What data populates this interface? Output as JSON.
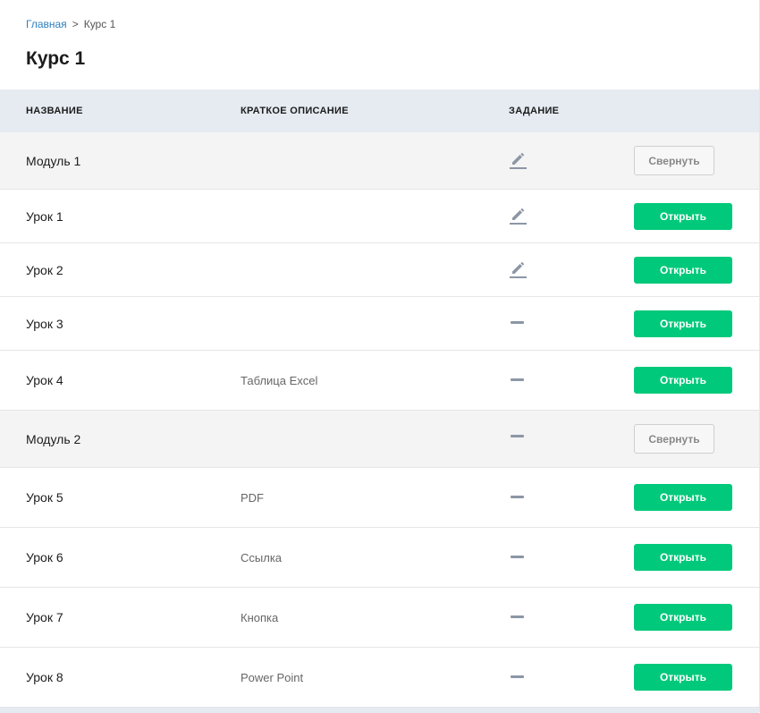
{
  "breadcrumb": {
    "home": "Главная",
    "separator": ">",
    "current": "Курс 1"
  },
  "page_title": "Курс 1",
  "table": {
    "headers": {
      "name": "НАЗВАНИЕ",
      "description": "КРАТКОЕ ОПИСАНИЕ",
      "task": "ЗАДАНИЕ"
    },
    "rows": [
      {
        "type": "module",
        "name": "Модуль 1",
        "description": "",
        "task_icon": "pencil-icon",
        "action": "Свернуть"
      },
      {
        "type": "lesson",
        "name": "Урок 1",
        "description": "",
        "task_icon": "pencil-icon",
        "action": "Открыть"
      },
      {
        "type": "lesson",
        "name": "Урок 2",
        "description": "",
        "task_icon": "pencil-icon",
        "action": "Открыть"
      },
      {
        "type": "lesson",
        "name": "Урок 3",
        "description": "",
        "task_icon": "dash-icon",
        "action": "Открыть"
      },
      {
        "type": "lesson",
        "name": "Урок 4",
        "description": "Таблица Excel",
        "task_icon": "dash-icon",
        "action": "Открыть"
      },
      {
        "type": "module",
        "name": "Модуль 2",
        "description": "",
        "task_icon": "dash-icon",
        "action": "Свернуть"
      },
      {
        "type": "lesson",
        "name": "Урок 5",
        "description": "PDF",
        "task_icon": "dash-icon",
        "action": "Открыть"
      },
      {
        "type": "lesson",
        "name": "Урок 6",
        "description": "Ссылка",
        "task_icon": "dash-icon",
        "action": "Открыть"
      },
      {
        "type": "lesson",
        "name": "Урок 7",
        "description": "Кнопка",
        "task_icon": "dash-icon",
        "action": "Открыть"
      },
      {
        "type": "lesson",
        "name": "Урок 8",
        "description": "Power Point",
        "task_icon": "dash-icon",
        "action": "Открыть"
      }
    ]
  },
  "colors": {
    "accent": "#00c97b",
    "link": "#2f7fbf",
    "header_bg": "#e6ebf2",
    "module_bg": "#f4f4f4",
    "icon": "#8c96a6"
  }
}
